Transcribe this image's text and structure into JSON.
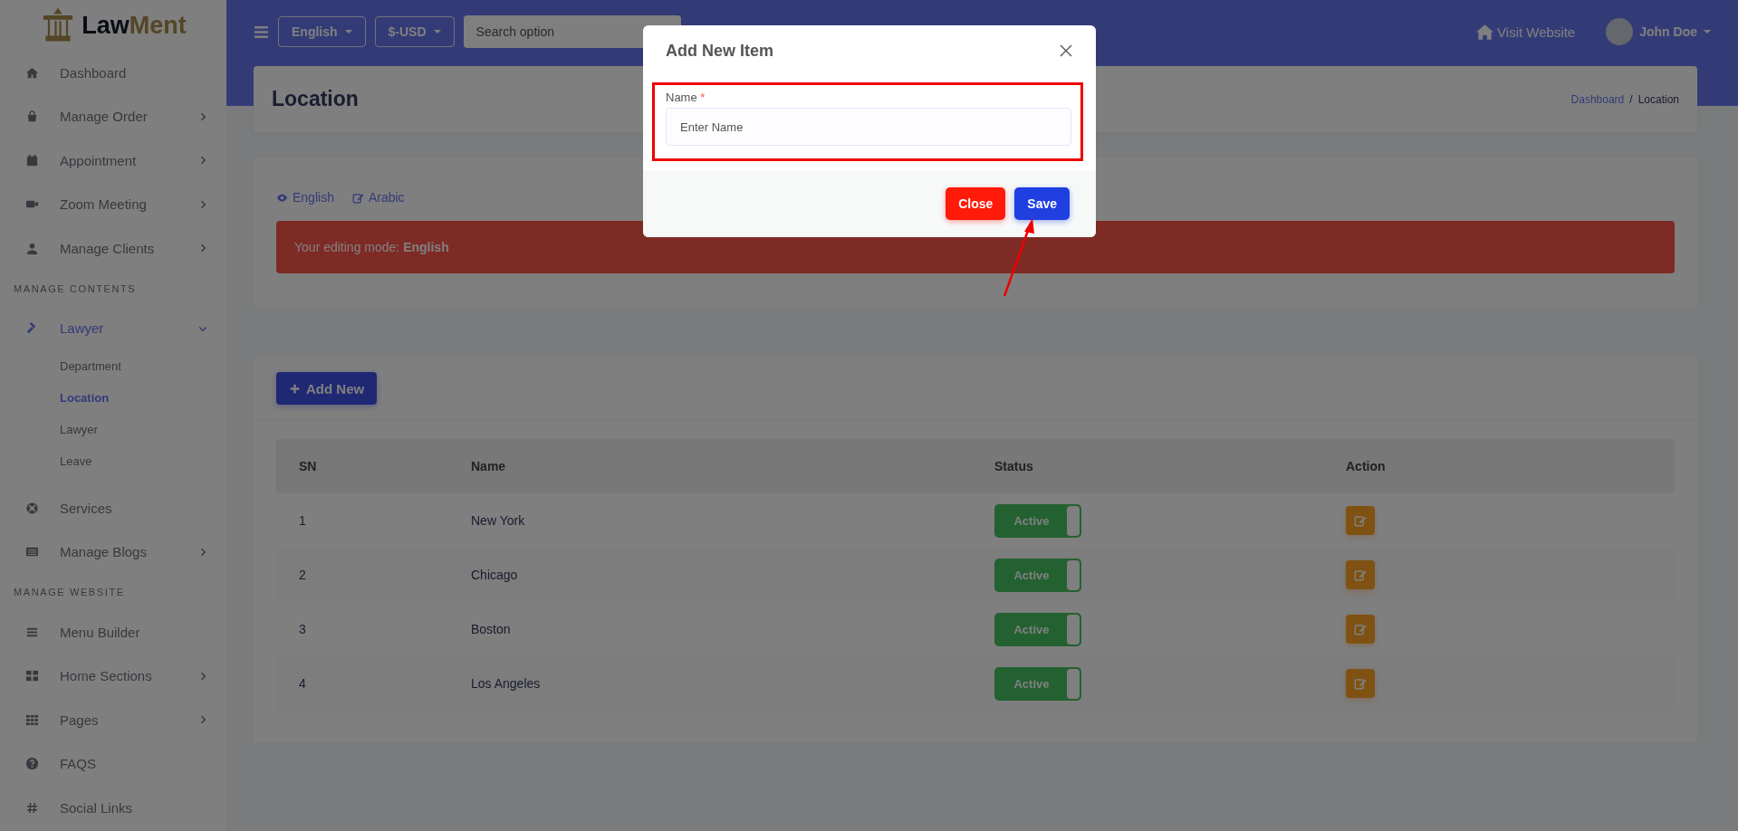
{
  "sidebar": {
    "logo_text": [
      "Law",
      "Ment"
    ],
    "sections": [
      {
        "items": [
          {
            "label": "Dashboard",
            "kind": "link",
            "selected": false
          },
          {
            "label": "Manage Order",
            "kind": "menu",
            "expanded": false,
            "selected": false
          },
          {
            "label": "Appointment",
            "kind": "menu",
            "expanded": false,
            "selected": false
          },
          {
            "label": "Zoom Meeting",
            "kind": "menu",
            "expanded": false,
            "selected": false
          },
          {
            "label": "Manage Clients",
            "kind": "menu",
            "expanded": false,
            "selected": false
          }
        ]
      },
      {
        "heading": "MANAGE CONTENTS",
        "items": [
          {
            "label": "Lawyer",
            "kind": "menu",
            "expanded": true,
            "selected": true,
            "children": [
              {
                "label": "Department",
                "selected": false
              },
              {
                "label": "Location",
                "selected": true
              },
              {
                "label": "Lawyer",
                "selected": false
              },
              {
                "label": "Leave",
                "selected": false
              }
            ]
          },
          {
            "label": "Services",
            "kind": "link",
            "selected": false
          },
          {
            "label": "Manage Blogs",
            "kind": "menu",
            "expanded": false,
            "selected": false
          }
        ]
      },
      {
        "heading": "MANAGE WEBSITE",
        "items": [
          {
            "label": "Menu Builder",
            "kind": "link",
            "selected": false
          },
          {
            "label": "Home Sections",
            "kind": "menu",
            "expanded": false,
            "selected": false
          },
          {
            "label": "Pages",
            "kind": "menu",
            "expanded": false,
            "selected": false
          },
          {
            "label": "FAQS",
            "kind": "link",
            "selected": false
          },
          {
            "label": "Social Links",
            "kind": "link",
            "selected": false
          }
        ]
      }
    ]
  },
  "topbar": {
    "language": "English",
    "currency": "$-USD",
    "search": {
      "placeholder": "Search option"
    },
    "visit_link": "Visit Website",
    "user": "John Doe"
  },
  "page_header": {
    "title": "Location",
    "breadcrumb": [
      "Dashboard",
      "Location"
    ],
    "breadcrumb_separator": "/"
  },
  "language_links": [
    "English",
    "Arabic"
  ],
  "alert": "Your editing mode: **English**",
  "table": {
    "add_button": "Add New",
    "columns": [
      "SN",
      "Name",
      "Status",
      "Action"
    ],
    "rows": [
      {
        "sn": "1",
        "name": "New York",
        "status": "Active",
        "active": true
      },
      {
        "sn": "2",
        "name": "Chicago",
        "status": "Active",
        "active": true
      },
      {
        "sn": "3",
        "name": "Boston",
        "status": "Active",
        "active": true
      },
      {
        "sn": "4",
        "name": "Los Angeles",
        "status": "Active",
        "active": true
      }
    ]
  },
  "modal": {
    "title": "Add New Item",
    "field": {
      "label": "Name",
      "required_mark": "*",
      "placeholder": "Enter Name"
    },
    "buttons": [
      {
        "label": "Close",
        "kind": "close"
      },
      {
        "label": "Save",
        "kind": "save"
      }
    ]
  }
}
